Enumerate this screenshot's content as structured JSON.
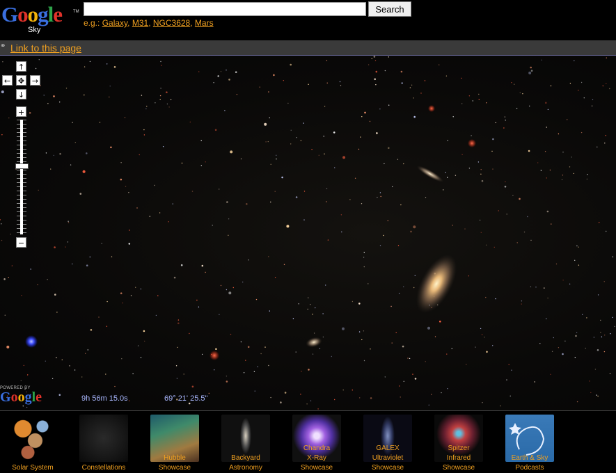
{
  "header": {
    "logo_text": "Google",
    "logo_sub": "Sky",
    "logo_tm": "TM",
    "search_value": "",
    "search_button": "Search",
    "examples_prefix": "e.g.:",
    "examples": [
      "Galaxy",
      "M31",
      "NGC3628",
      "Mars"
    ]
  },
  "linkbar": {
    "link_label": "Link to this page"
  },
  "map": {
    "controls": {
      "up": "↑",
      "down": "↓",
      "left": "←",
      "right": "→",
      "center": "✥",
      "zoom_in": "+",
      "zoom_out": "−"
    },
    "zoom_level_fraction": 0.6,
    "powered_by": "POWERED BY",
    "powered_logo": "Google",
    "ra": "9h 56m 15.0s",
    "dec": "69°  21' 25.5\""
  },
  "showcase": {
    "items": [
      {
        "line1": "Solar System",
        "line2": ""
      },
      {
        "line1": "Constellations",
        "line2": ""
      },
      {
        "line1": "Hubble",
        "line2": "Showcase"
      },
      {
        "line1": "Backyard",
        "line2": "Astronomy"
      },
      {
        "line1": "Chandra",
        "line2": "X-Ray",
        "line3": "Showcase"
      },
      {
        "line1": "GALEX",
        "line2": "Ultraviolet",
        "line3": "Showcase"
      },
      {
        "line1": "Spitzer",
        "line2": "Infrared",
        "line3": "Showcase"
      },
      {
        "line1": "Earth & Sky",
        "line2": "Podcasts"
      }
    ]
  },
  "colors": {
    "accent": "#f0a020",
    "coord": "#aab8ff",
    "linkbar": "#3a3a3a"
  }
}
